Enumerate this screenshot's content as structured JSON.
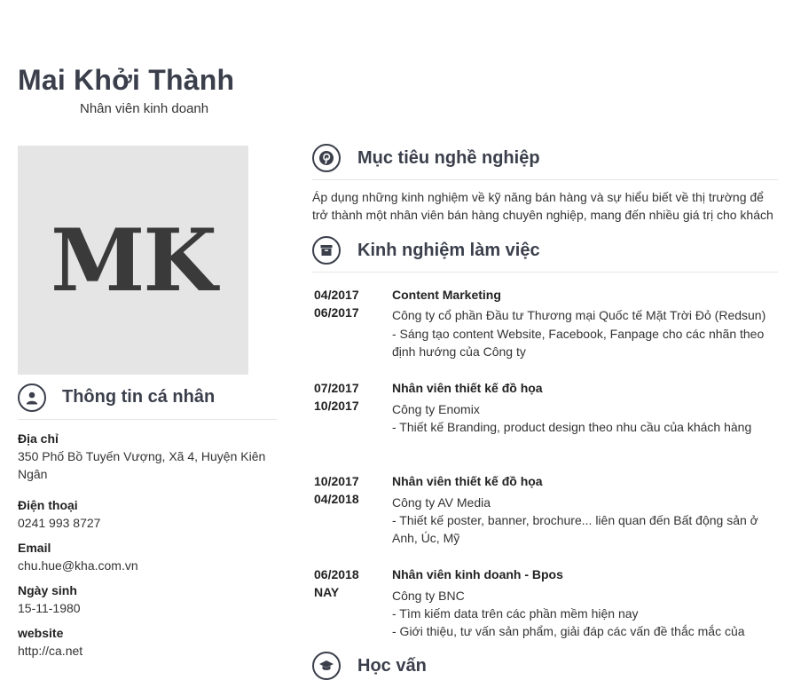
{
  "header": {
    "name": "Mai Khởi Thành",
    "title": "Nhân viên kinh doanh"
  },
  "avatar": {
    "initials": "MK"
  },
  "personal": {
    "heading": "Thông tin cá nhân",
    "icon": "user-icon",
    "fields": [
      {
        "label": "Địa chỉ",
        "value": "350 Phố Bồ Tuyến Vượng, Xã 4, Huyện Kiên Ngân"
      },
      {
        "label": "Điện thoại",
        "value": "0241 993 8727"
      },
      {
        "label": "Email",
        "value": "chu.hue@kha.com.vn"
      },
      {
        "label": "Ngày sinh",
        "value": "15-11-1980"
      },
      {
        "label": "website",
        "value": "http://ca.net"
      }
    ]
  },
  "objective": {
    "heading": "Mục tiêu nghề nghiệp",
    "icon": "pinterest-icon",
    "text": "Áp dụng những kinh nghiệm về kỹ năng bán hàng và sự hiểu biết về thị trường để trở thành một nhân viên bán hàng chuyên nghiệp, mang đến nhiều giá trị cho khách"
  },
  "experience": {
    "heading": "Kinh nghiệm làm việc",
    "icon": "archive-box-icon",
    "items": [
      {
        "start": "04/2017",
        "end": "06/2017",
        "position": "Content Marketing",
        "company": "Công ty cổ phần Đầu tư Thương mại Quốc tế Mặt Trời Đỏ (Redsun)",
        "desc": "-  Sáng tạo content Website, Facebook, Fanpage cho các nhãn theo định hướng của Công ty"
      },
      {
        "start": "07/2017",
        "end": "10/2017",
        "position": "Nhân viên thiết kế đồ họa",
        "company": "Công ty Enomix",
        "desc": "- Thiết kế Branding, product design theo nhu cầu của khách hàng"
      },
      {
        "start": "10/2017",
        "end": "04/2018",
        "position": "Nhân viên thiết kế đồ họa",
        "company": "Công ty AV Media",
        "desc": "- Thiết kế poster, banner, brochure... liên quan đến Bất động sản ở Anh, Úc, Mỹ"
      },
      {
        "start": "06/2018",
        "end": "NAY",
        "position": "Nhân viên kinh doanh - Bpos",
        "company": "Công ty BNC",
        "desc": "- Tìm kiếm data trên các phần mềm hiện nay\n- Giới thiệu, tư vấn sản phẩm, giải đáp các vấn đề thắc mắc của"
      }
    ]
  },
  "next_section": {
    "heading": "Học vấn",
    "icon": "graduation-cap-icon"
  },
  "colors": {
    "heading": "#3a3f4b",
    "avatar_bg": "#e5e5e5",
    "rule": "#e6e6e6"
  }
}
